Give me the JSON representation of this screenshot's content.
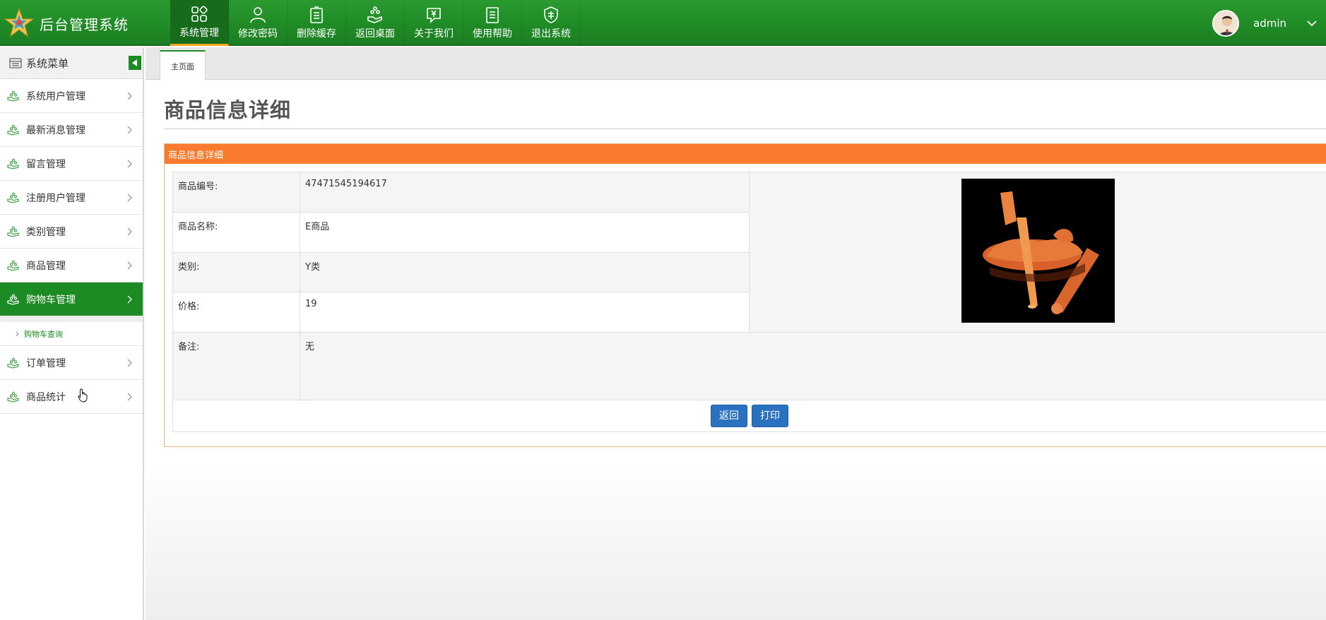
{
  "header": {
    "logo_text": "后台管理系统",
    "nav": [
      {
        "label": "系统管理",
        "icon": "grid-icon",
        "active": true
      },
      {
        "label": "修改密码",
        "icon": "user-icon"
      },
      {
        "label": "删除缓存",
        "icon": "clipboard-icon"
      },
      {
        "label": "返回桌面",
        "icon": "hand-coins-icon"
      },
      {
        "label": "关于我们",
        "icon": "yen-chat-icon"
      },
      {
        "label": "使用帮助",
        "icon": "notebook-icon"
      },
      {
        "label": "退出系统",
        "icon": "quality-badge-icon"
      }
    ],
    "user_name": "admin"
  },
  "sidebar": {
    "title": "系统菜单",
    "items": [
      {
        "label": "系统用户管理"
      },
      {
        "label": "最新消息管理"
      },
      {
        "label": "留言管理"
      },
      {
        "label": "注册用户管理"
      },
      {
        "label": "类别管理"
      },
      {
        "label": "商品管理"
      },
      {
        "label": "购物车管理",
        "active": true
      },
      {
        "label": "订单管理"
      },
      {
        "label": "商品统计"
      }
    ],
    "submenu_label": "购物车查询"
  },
  "tabs": {
    "home": "主页面"
  },
  "page": {
    "title": "商品信息详细",
    "panel_title": "商品信息详细",
    "fields": [
      {
        "label": "商品编号:",
        "value": "47471545194617"
      },
      {
        "label": "商品名称:",
        "value": "E商品"
      },
      {
        "label": "类别:",
        "value": "Y类"
      },
      {
        "label": "价格:",
        "value": "19"
      },
      {
        "label": "备注:",
        "value": "无"
      }
    ],
    "buttons": {
      "back": "返回",
      "print": "打印"
    }
  },
  "colors": {
    "header_green": "#1f8a25",
    "panel_orange": "#fb7b2e",
    "button_blue": "#2a72c0"
  }
}
